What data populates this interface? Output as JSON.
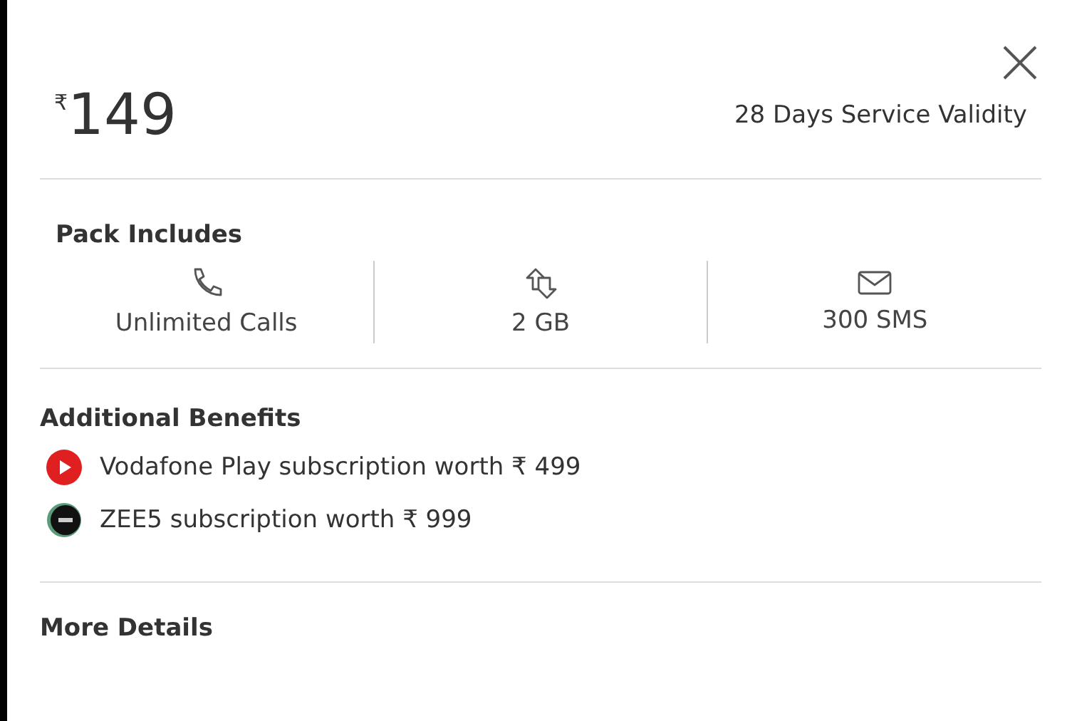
{
  "price": {
    "currency": "₹",
    "amount": "149"
  },
  "validity": "28 Days Service Validity",
  "pack": {
    "title": "Pack Includes",
    "items": [
      {
        "kind": "calls",
        "label": "Unlimited Calls"
      },
      {
        "kind": "data",
        "label": "2 GB"
      },
      {
        "kind": "sms",
        "label": "300 SMS"
      }
    ]
  },
  "benefits": {
    "title": "Additional Benefits",
    "items": [
      {
        "kind": "play",
        "text": "Vodafone Play subscription worth ₹ 499"
      },
      {
        "kind": "zee5",
        "text": "ZEE5 subscription worth ₹ 999"
      }
    ]
  },
  "more_details": "More Details"
}
